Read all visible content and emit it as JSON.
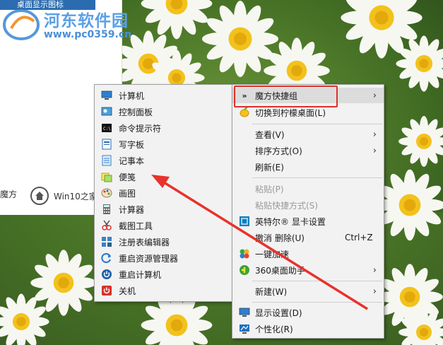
{
  "watermark": {
    "top_strip": "桌面显示图标",
    "site_name": "河东软件园",
    "site_url": "www.pc0359.cn"
  },
  "background_window": {
    "left_text": "魔方",
    "home_label": "Win10之家"
  },
  "submenu": {
    "items": [
      {
        "label": "计算机",
        "icon": "computer-icon"
      },
      {
        "label": "控制面板",
        "icon": "control-panel-icon"
      },
      {
        "label": "命令提示符",
        "icon": "command-prompt-icon"
      },
      {
        "label": "写字板",
        "icon": "wordpad-icon"
      },
      {
        "label": "记事本",
        "icon": "notepad-icon"
      },
      {
        "label": "便笺",
        "icon": "sticky-notes-icon"
      },
      {
        "label": "画图",
        "icon": "paint-icon"
      },
      {
        "label": "计算器",
        "icon": "calculator-icon"
      },
      {
        "label": "截图工具",
        "icon": "snipping-tool-icon"
      },
      {
        "label": "注册表编辑器",
        "icon": "registry-editor-icon"
      },
      {
        "label": "重启资源管理器",
        "icon": "restart-explorer-icon"
      },
      {
        "label": "重启计算机",
        "icon": "restart-computer-icon"
      },
      {
        "label": "关机",
        "icon": "shutdown-icon"
      }
    ]
  },
  "context_menu": {
    "items": [
      {
        "label": "魔方快捷组",
        "icon": "double-chevron-icon",
        "arrow": true
      },
      {
        "label": "切换到柠檬桌面(L)",
        "icon": "lemon-icon"
      },
      {
        "label": "查看(V)",
        "arrow": true
      },
      {
        "label": "排序方式(O)",
        "arrow": true
      },
      {
        "label": "刷新(E)"
      },
      {
        "label": "粘贴(P)",
        "disabled": true
      },
      {
        "label": "粘贴快捷方式(S)",
        "disabled": true
      },
      {
        "label": "英特尔® 显卡设置",
        "icon": "intel-graphics-icon"
      },
      {
        "label": "撤消 删除(U)",
        "shortcut": "Ctrl+Z"
      },
      {
        "label": "一键加速",
        "icon": "speedup-icon"
      },
      {
        "label": "360桌面助手",
        "icon": "desktop-assistant-icon",
        "arrow": true
      },
      {
        "label": "新建(W)",
        "arrow": true
      },
      {
        "label": "显示设置(D)",
        "icon": "display-settings-icon"
      },
      {
        "label": "个性化(R)",
        "icon": "personalize-icon"
      }
    ]
  },
  "colors": {
    "highlight_border": "#e0302a",
    "annotation_arrow": "#e8322b"
  }
}
